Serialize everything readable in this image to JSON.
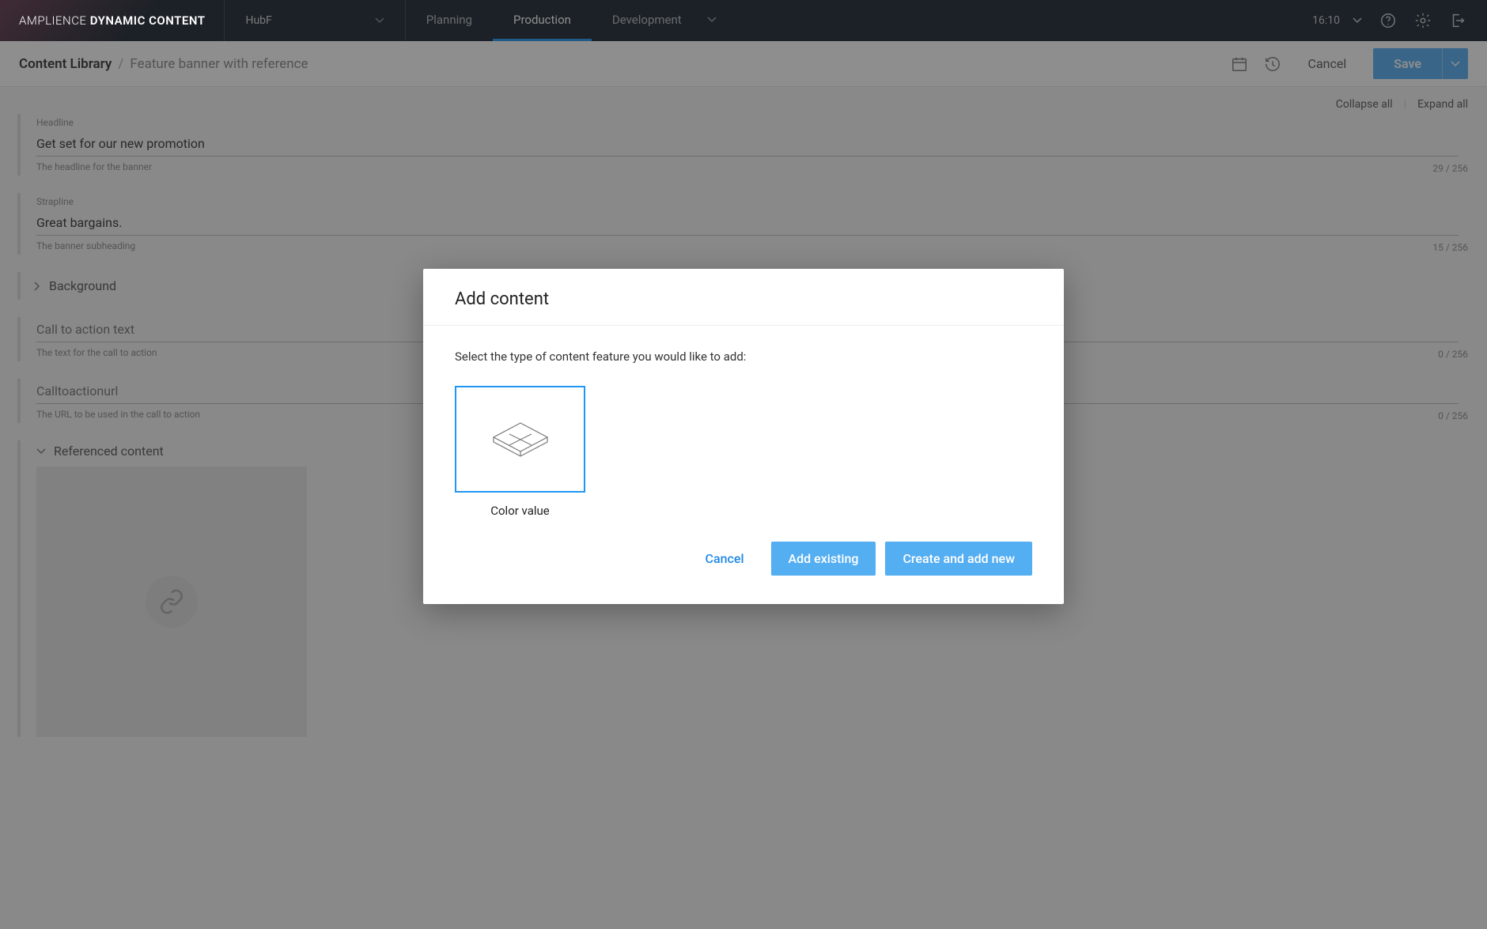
{
  "brand": {
    "thin": "AMPLIENCE",
    "bold": "DYNAMIC CONTENT"
  },
  "hub": {
    "name": "HubF"
  },
  "nav": {
    "planning": "Planning",
    "production": "Production",
    "development": "Development"
  },
  "topbar": {
    "time": "16:10"
  },
  "breadcrumb": {
    "root": "Content Library",
    "sep": "/",
    "leaf": "Feature banner with reference"
  },
  "subheader": {
    "cancel": "Cancel",
    "save": "Save"
  },
  "toprow": {
    "collapse": "Collapse all",
    "expand": "Expand all"
  },
  "fields": {
    "headline": {
      "label": "Headline",
      "value": "Get set for our new promotion",
      "hint": "The headline for the banner",
      "count": "29 / 256"
    },
    "strapline": {
      "label": "Strapline",
      "value": "Great bargains.",
      "hint": "The banner subheading",
      "count": "15 / 256"
    },
    "background": {
      "label": "Background"
    },
    "cta_text": {
      "label": "Call to action text",
      "value": "",
      "hint": "The text for the call to action",
      "count": "0 / 256"
    },
    "cta_url": {
      "label": "Calltoactionurl",
      "value": "",
      "hint": "The URL to be used in the call to action",
      "count": "0 / 256"
    },
    "referenced": {
      "label": "Referenced content"
    }
  },
  "modal": {
    "title": "Add content",
    "instruction": "Select the type of content feature you would like to add:",
    "types": {
      "color_value": "Color value"
    },
    "buttons": {
      "cancel": "Cancel",
      "add_existing": "Add existing",
      "create_new": "Create and add new"
    }
  }
}
